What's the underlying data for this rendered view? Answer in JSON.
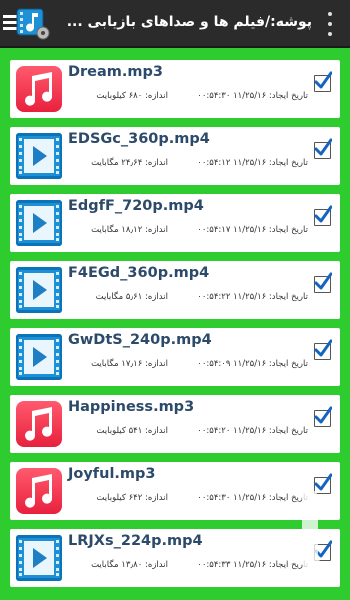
{
  "header": {
    "title": "پوشه:/فیلم ها و صداهای بازیابی ...",
    "logo_icon": "film-music-app-icon",
    "menu_icon": "overflow-menu-icon"
  },
  "colors": {
    "background_green": "#2ecc2e",
    "appbar": "#2b2b2b",
    "music_red": "#e8213d",
    "video_blue": "#0b73b9",
    "checkbox_blue": "#1565c0"
  },
  "files": [
    {
      "name": "Dream.mp3",
      "type": "music",
      "date": "تاریخ ایجاد: ۱۱/۲۵/۱۶ ۰۰:۵۴:۳۰",
      "size": "اندازه: ۶۸۰ کیلوبایت",
      "checked": true
    },
    {
      "name": "EDSGc_360p.mp4",
      "type": "video",
      "date": "تاریخ ایجاد: ۱۱/۲۵/۱۶ ۰۰:۵۴:۱۲",
      "size": "اندازه: ۲۴٫۶۴ مگابایت",
      "checked": true
    },
    {
      "name": "EdgfF_720p.mp4",
      "type": "video",
      "date": "تاریخ ایجاد: ۱۱/۲۵/۱۶ ۰۰:۵۴:۱۷",
      "size": "اندازه: ۱۸٫۱۲ مگابایت",
      "checked": true
    },
    {
      "name": "F4EGd_360p.mp4",
      "type": "video",
      "date": "تاریخ ایجاد: ۱۱/۲۵/۱۶ ۰۰:۵۴:۲۲",
      "size": "اندازه: ۵٫۶۱ مگابایت",
      "checked": true
    },
    {
      "name": "GwDtS_240p.mp4",
      "type": "video",
      "date": "تاریخ ایجاد: ۱۱/۲۵/۱۶ ۰۰:۵۴:۰۹",
      "size": "اندازه: ۱۷٫۱۶ مگابایت",
      "checked": true
    },
    {
      "name": "Happiness.mp3",
      "type": "music",
      "date": "تاریخ ایجاد: ۱۱/۲۵/۱۶ ۰۰:۵۴:۲۰",
      "size": "اندازه: ۵۴۱ کیلوبایت",
      "checked": true
    },
    {
      "name": "Joyful.mp3",
      "type": "music",
      "date": "تاریخ ایجاد: ۱۱/۲۵/۱۶ ۰۰:۵۴:۳۰",
      "size": "اندازه: ۶۴۲ کیلوبایت",
      "checked": true
    },
    {
      "name": "LRJXs_224p.mp4",
      "type": "video",
      "date": "تاریخ ایجاد: ۱۱/۲۵/۱۶ ۰۰:۵۴:۳۳",
      "size": "اندازه: ۱۳٫۸۰ مگابایت",
      "checked": true
    }
  ]
}
